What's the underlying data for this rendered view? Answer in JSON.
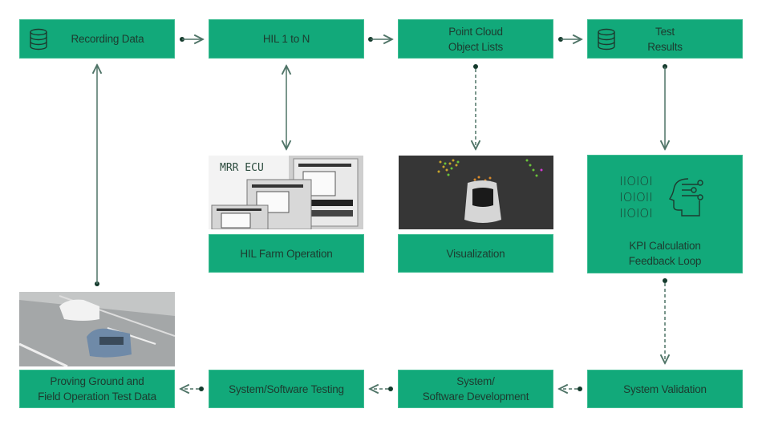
{
  "colors": {
    "box_fill": "#12a97a",
    "text": "#1d3b2f",
    "connector": "#4e7366",
    "dot": "#143a2c"
  },
  "nodes": {
    "recording_data": {
      "label": "Recording Data",
      "icon": "database-icon"
    },
    "hil_1_to_n": {
      "label": "HIL 1 to N"
    },
    "point_cloud": {
      "label": "Point Cloud\nObject Lists"
    },
    "test_results": {
      "label": "Test\nResults",
      "icon": "database-icon"
    },
    "hil_farm": {
      "label": "HIL Farm Operation",
      "image_caption": "MRR  ECU"
    },
    "visualization": {
      "label": "Visualization"
    },
    "kpi": {
      "label": "KPI Calculation\nFeedback Loop",
      "binary": [
        "IIOIOI",
        "IOIOII",
        "IIOIOI"
      ],
      "icon": "ai-head-icon"
    },
    "proving_ground": {
      "label": "Proving Ground and\nField Operation Test Data"
    },
    "sw_testing": {
      "label": "System/Software Testing"
    },
    "sw_development": {
      "label": "System/\nSoftware Development"
    },
    "system_validation": {
      "label": "System Validation"
    }
  }
}
